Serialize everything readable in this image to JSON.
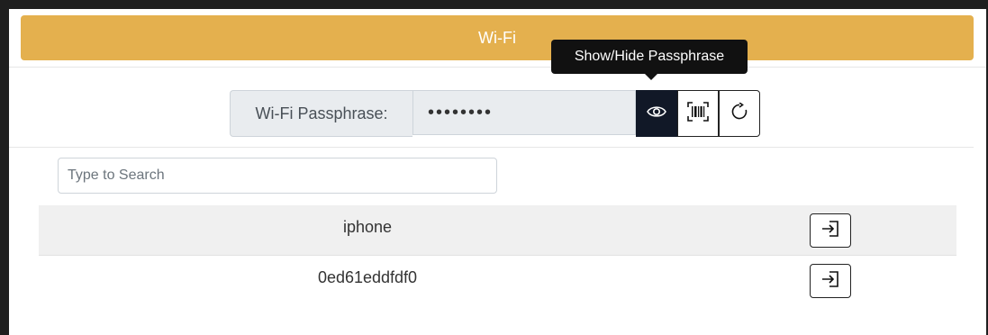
{
  "header": {
    "title": "Wi-Fi"
  },
  "tooltip": {
    "text": "Show/Hide Passphrase"
  },
  "passphrase": {
    "label": "Wi-Fi Passphrase:",
    "masked_value": "••••••••",
    "buttons": [
      {
        "icon": "eye-icon",
        "active": true
      },
      {
        "icon": "barcode-icon",
        "active": false
      },
      {
        "icon": "refresh-icon",
        "active": false
      }
    ]
  },
  "search": {
    "placeholder": "Type to Search",
    "value": ""
  },
  "networks": [
    {
      "name": "iphone"
    },
    {
      "name": "0ed61eddfdf0"
    }
  ],
  "colors": {
    "header": "#e4b04e",
    "active_button": "#111827"
  }
}
